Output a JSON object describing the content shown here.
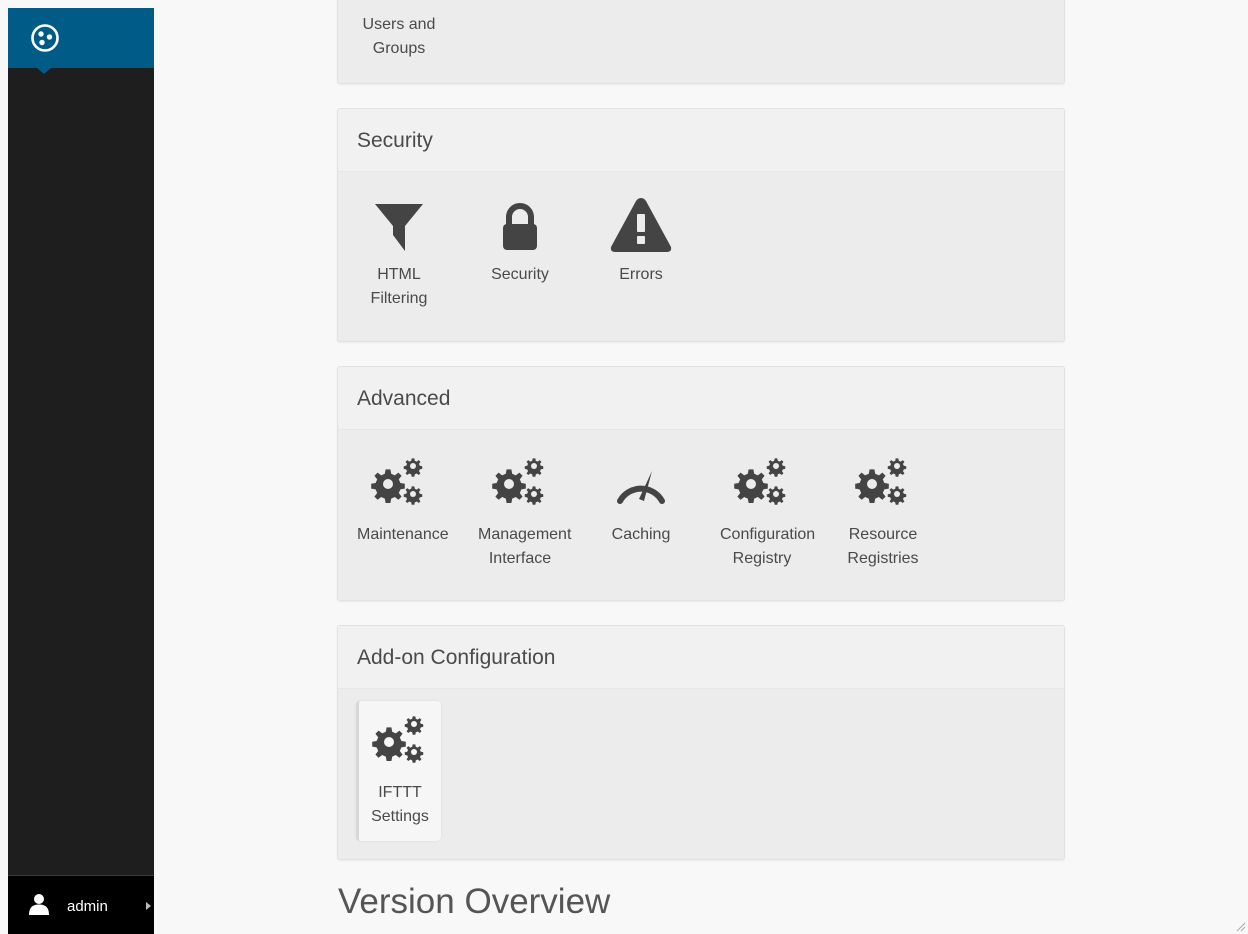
{
  "sidebar": {
    "logo_icon": "plone-logo-icon",
    "user": {
      "name": "admin",
      "icon": "user-icon"
    }
  },
  "users_panel": {
    "item": {
      "label": "Users and Groups"
    }
  },
  "security_panel": {
    "title": "Security",
    "items": [
      {
        "label": "HTML Filtering",
        "icon": "filter-icon"
      },
      {
        "label": "Security",
        "icon": "lock-icon"
      },
      {
        "label": "Errors",
        "icon": "warning-icon"
      }
    ]
  },
  "advanced_panel": {
    "title": "Advanced",
    "items": [
      {
        "label": "Maintenance",
        "icon": "gears-icon"
      },
      {
        "label": "Management Interface",
        "icon": "gears-icon"
      },
      {
        "label": "Caching",
        "icon": "dashboard-icon"
      },
      {
        "label": "Configuration Registry",
        "icon": "gears-icon"
      },
      {
        "label": "Resource Registries",
        "icon": "gears-icon"
      }
    ]
  },
  "addon_panel": {
    "title": "Add-on Configuration",
    "items": [
      {
        "label": "IFTTT Settings",
        "icon": "gears-icon"
      }
    ]
  },
  "version_overview": {
    "title": "Version Overview"
  },
  "colors": {
    "sidebar_bg": "#1e1e1e",
    "logo_bg": "#005b87",
    "panel_bg": "#ececec",
    "icon": "#444444"
  }
}
